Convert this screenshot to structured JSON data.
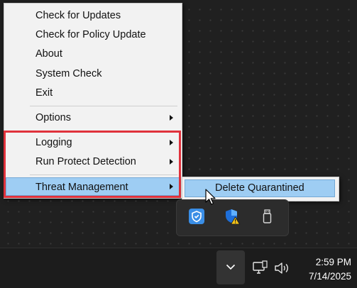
{
  "menu": {
    "items": [
      {
        "label": "Check for Updates"
      },
      {
        "label": "Check for Policy Update"
      },
      {
        "label": "About"
      },
      {
        "label": "System Check"
      },
      {
        "label": "Exit"
      },
      {
        "label": "Options"
      },
      {
        "label": "Logging"
      },
      {
        "label": "Run Protect Detection"
      },
      {
        "label": "Threat Management"
      }
    ]
  },
  "submenu": {
    "items": [
      {
        "label": "Delete Quarantined"
      }
    ]
  },
  "tray_flyout": {
    "icons": [
      "shield-app-icon",
      "defender-warning-icon",
      "usb-drive-icon"
    ]
  },
  "taskbar": {
    "icons": [
      "chevron-up-icon",
      "network-icon",
      "volume-icon"
    ],
    "time": "2:59 PM",
    "date": "7/14/2025"
  },
  "colors": {
    "highlight": "#9ecdf3",
    "annotation_box": "#e0323c",
    "desktop_bg": "#202020"
  }
}
